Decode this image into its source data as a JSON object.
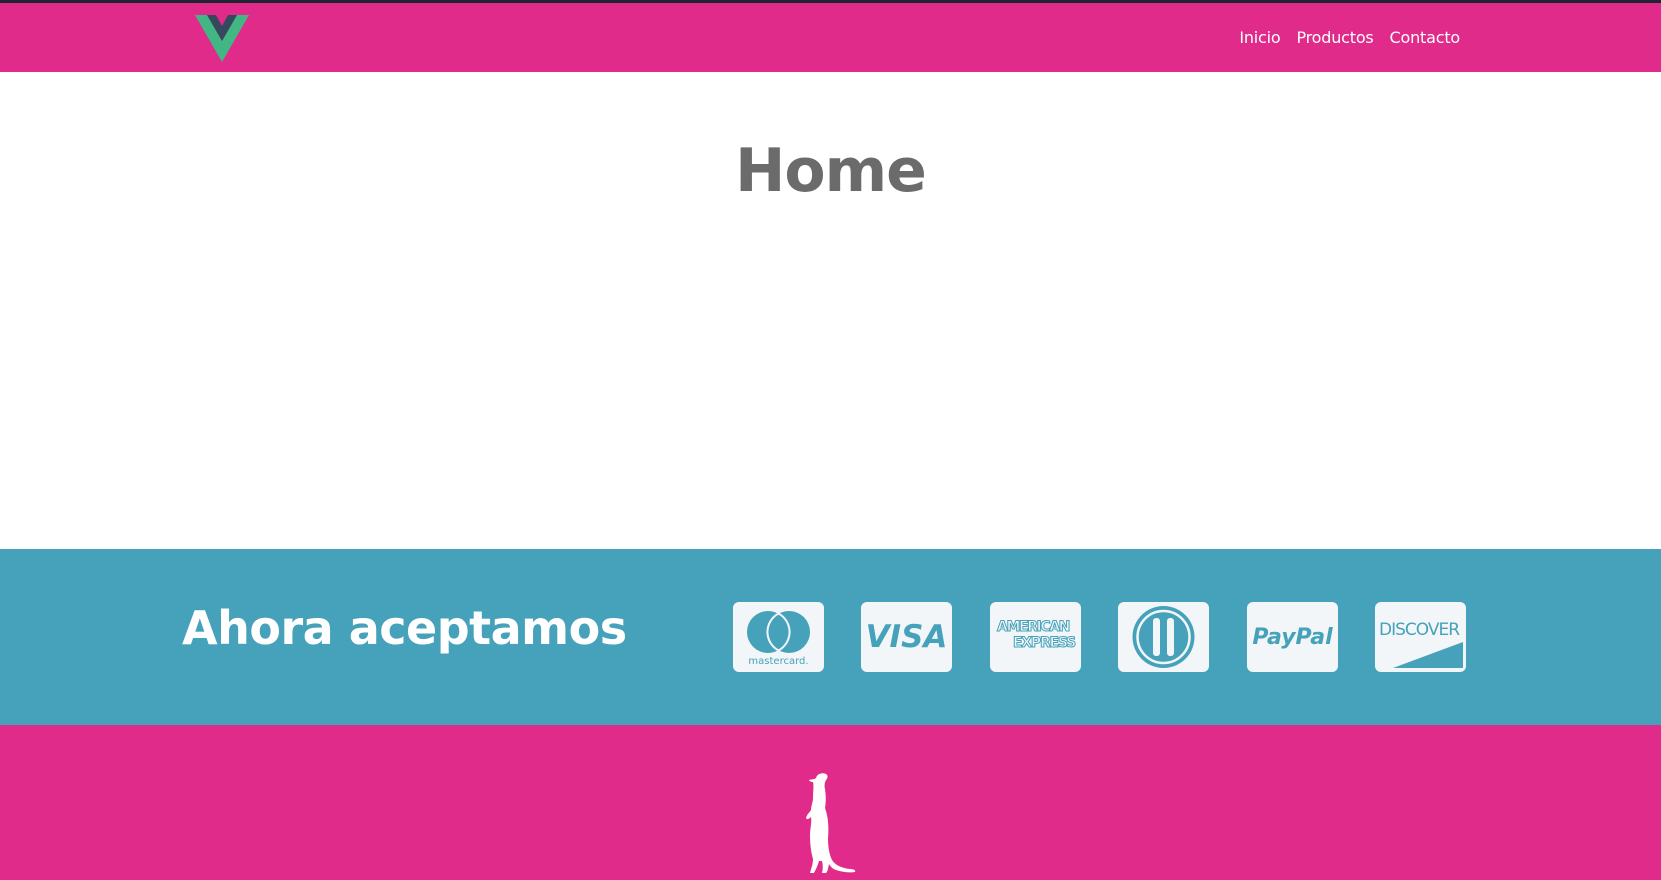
{
  "navbar": {
    "logo": {
      "icon": "vue-logo-icon",
      "colors": {
        "outer": "#41b883",
        "inner": "#35495e"
      }
    },
    "links": [
      {
        "label": "Inicio"
      },
      {
        "label": "Productos"
      },
      {
        "label": "Contacto"
      }
    ],
    "background": "#e02b8a"
  },
  "main": {
    "title": "Home"
  },
  "payments": {
    "heading": "Ahora aceptamos",
    "background": "#45a2ba",
    "cards": [
      {
        "icon": "mastercard-icon",
        "text": "mastercard."
      },
      {
        "icon": "visa-icon",
        "text": "VISA"
      },
      {
        "icon": "american-express-icon",
        "text": "AMERICAN EXPRESS"
      },
      {
        "icon": "diners-club-icon"
      },
      {
        "icon": "paypal-icon",
        "text": "PayPal"
      },
      {
        "icon": "discover-icon",
        "text": "DISCOVER"
      }
    ]
  },
  "footer": {
    "icon": "meerkat-icon",
    "background": "#e02b8a"
  }
}
